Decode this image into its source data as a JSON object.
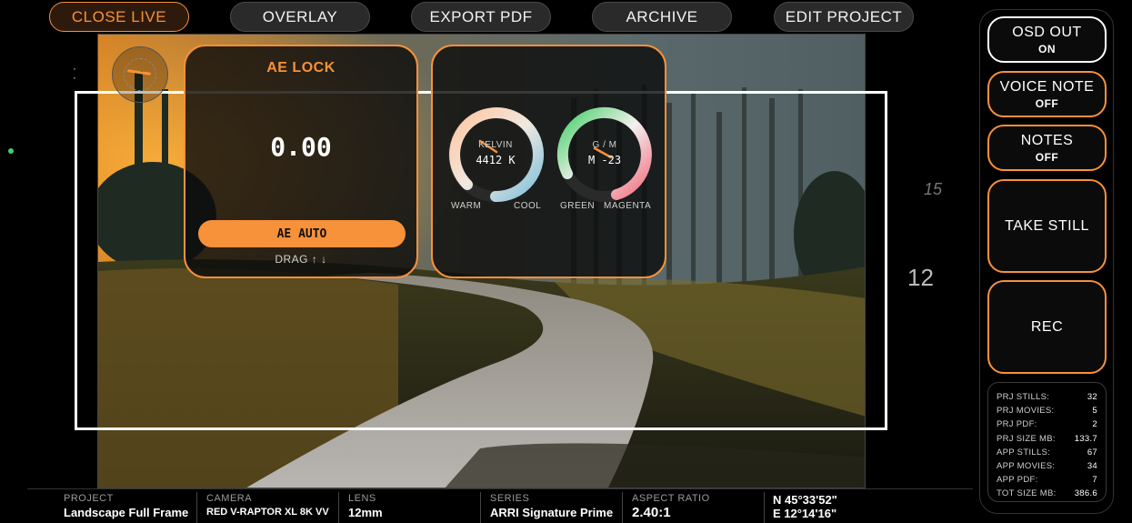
{
  "topbar": {
    "buttons": [
      "CLOSE LIVE",
      "OVERLAY",
      "EXPORT PDF",
      "ARCHIVE",
      "EDIT PROJECT"
    ]
  },
  "overlay": {
    "focus_marks": [
      "15",
      "12"
    ]
  },
  "ae": {
    "title": "AE LOCK",
    "value": "0.00",
    "auto_label": "AE AUTO",
    "drag_hint": "DRAG ↑ ↓"
  },
  "wb": {
    "kelvin": {
      "label": "KELVIN",
      "value": "4412 K",
      "low": "WARM",
      "high": "COOL"
    },
    "gm": {
      "label": "G / M",
      "value": "M -23",
      "low": "GREEN",
      "high": "MAGENTA"
    }
  },
  "right": {
    "osd": {
      "title": "OSD OUT",
      "state": "ON"
    },
    "voice": {
      "title": "VOICE NOTE",
      "state": "OFF"
    },
    "notes": {
      "title": "NOTES",
      "state": "OFF"
    },
    "still": {
      "title": "TAKE STILL"
    },
    "rec": {
      "title": "REC"
    }
  },
  "stats": [
    {
      "label": "PRJ STILLS:",
      "value": "32"
    },
    {
      "label": "PRJ MOVIES:",
      "value": "5"
    },
    {
      "label": "PRJ PDF:",
      "value": "2"
    },
    {
      "label": "PRJ SIZE MB:",
      "value": "133.7"
    },
    {
      "label": "APP STILLS:",
      "value": "67"
    },
    {
      "label": "APP MOVIES:",
      "value": "34"
    },
    {
      "label": "APP PDF:",
      "value": "7"
    },
    {
      "label": "TOT SIZE MB:",
      "value": "386.6"
    }
  ],
  "info": {
    "project": {
      "label": "PROJECT",
      "value": "Landscape Full Frame"
    },
    "camera": {
      "label": "CAMERA",
      "value": "RED V-RAPTOR XL 8K VV"
    },
    "lens": {
      "label": "LENS",
      "value": "12mm"
    },
    "series": {
      "label": "SERIES",
      "value": "ARRI Signature Prime"
    },
    "aspect": {
      "label": "ASPECT RATIO",
      "value": "2.40:1"
    },
    "gps": {
      "lat": "N 45°33'52\"",
      "lon": "E 12°14'16\""
    }
  },
  "colors": {
    "accent": "#f7913a",
    "panel_bg": "#0c0c0c",
    "button_bg": "#2a2a2a"
  }
}
